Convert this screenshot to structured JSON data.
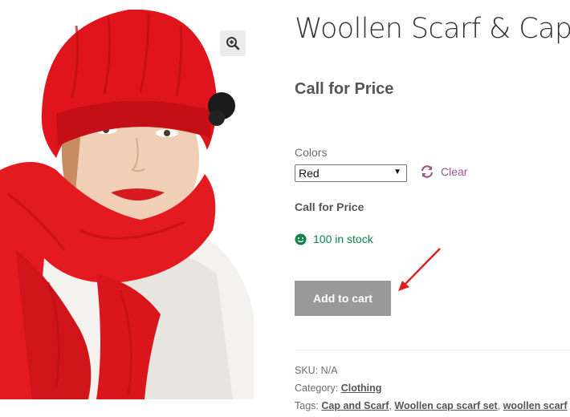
{
  "product": {
    "title": "Woollen Scarf & Cap",
    "price_main": "Call for Price",
    "variation_label": "Colors",
    "selected_color": "Red",
    "clear_label": "Clear",
    "price_variation": "Call for Price",
    "stock_text": "100 in stock",
    "add_to_cart": "Add to cart"
  },
  "meta": {
    "sku_label": "SKU:",
    "sku_value": "N/A",
    "category_label": "Category:",
    "category": "Clothing",
    "tags_label": "Tags:",
    "tags": [
      "Cap and Scarf",
      "Woollen cap scarf set",
      "woollen scarf"
    ],
    "tag_separator": ","
  },
  "icons": {
    "zoom": "magnifier-plus-icon",
    "clear": "refresh-icon",
    "stock": "smiley-icon"
  },
  "colors": {
    "accent": "#96588a",
    "stock": "#0f834d",
    "button_bg": "#999999",
    "annotation_arrow": "#e02020"
  }
}
